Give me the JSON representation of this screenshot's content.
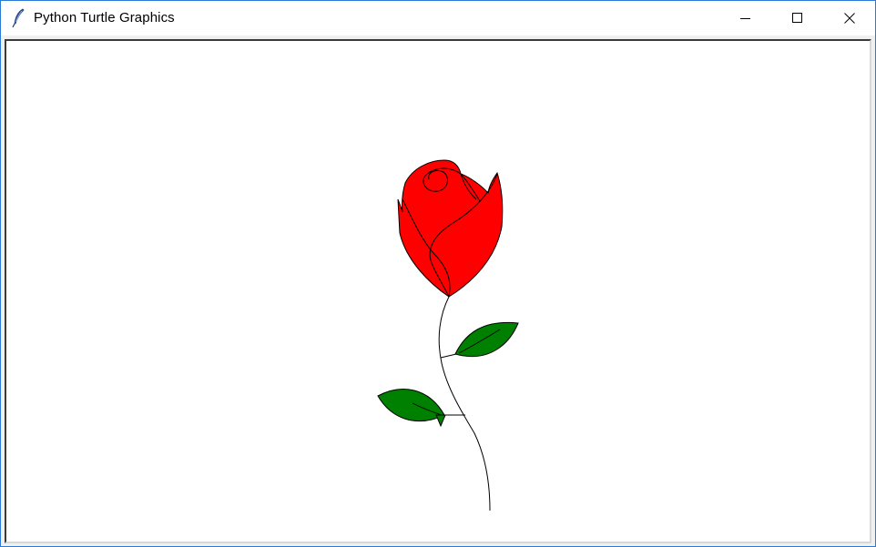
{
  "window": {
    "title": "Python Turtle Graphics",
    "controls": {
      "minimize": "minimize",
      "maximize": "maximize",
      "close": "close"
    }
  },
  "colors": {
    "title_border": "#2b7bd6",
    "petal_fill": "#ff0000",
    "leaf_fill": "#008000",
    "stroke": "#000000",
    "canvas_bg": "#ffffff"
  },
  "icons": {
    "app": "feather-icon",
    "minimize": "minimize-icon",
    "maximize": "maximize-icon",
    "close": "close-icon"
  }
}
